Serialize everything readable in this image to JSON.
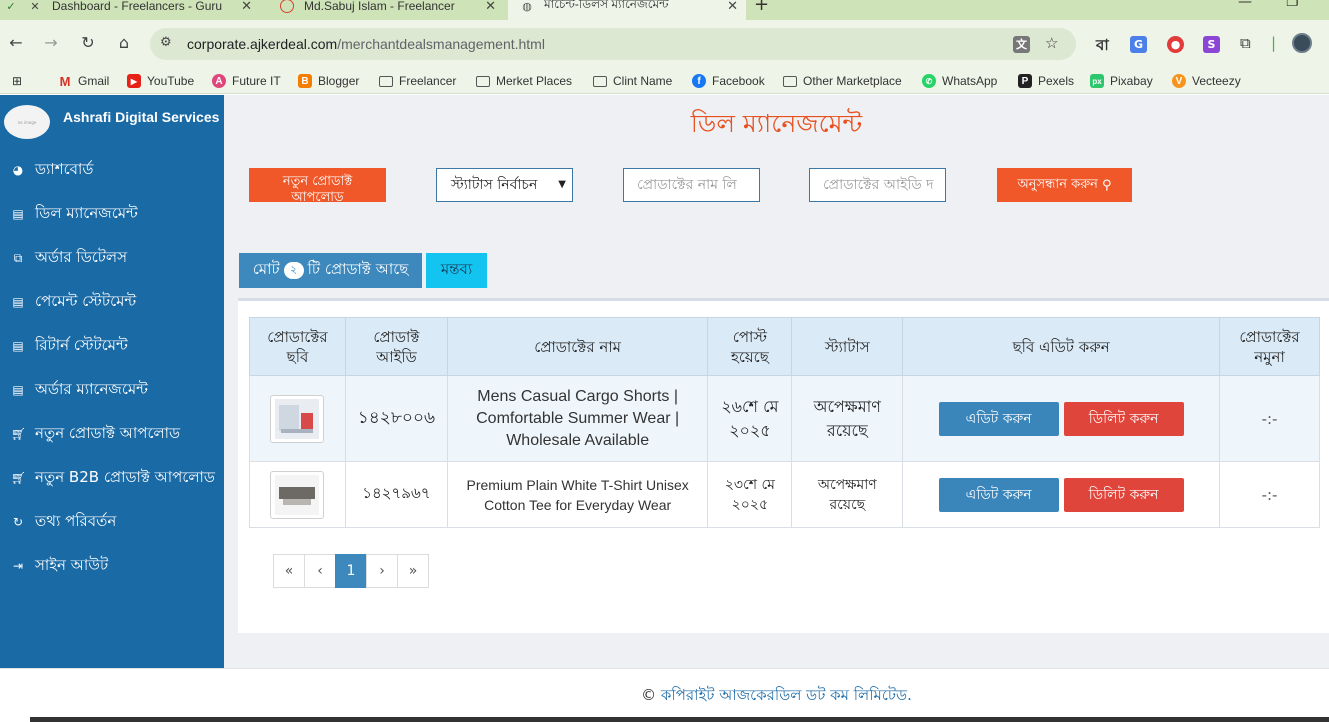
{
  "browser": {
    "tabs": [
      {
        "label": "Dashboard - Freelancers - Guru"
      },
      {
        "label": "Md.Sabuj Islam - Freelancer"
      },
      {
        "label": "মার্চেন্ট-ডিলস ম্যানেজমেন্ট"
      }
    ],
    "url_host": "corporate.ajkerdeal.com",
    "url_path": "/merchantdealsmanagement.html",
    "lang_badge": "বা",
    "bookmarks": [
      {
        "label": "Gmail"
      },
      {
        "label": "YouTube"
      },
      {
        "label": "Future IT"
      },
      {
        "label": "Blogger"
      },
      {
        "label": "Freelancer"
      },
      {
        "label": "Merket Places"
      },
      {
        "label": "Clint Name"
      },
      {
        "label": "Facebook"
      },
      {
        "label": "Other Marketplace"
      },
      {
        "label": "WhatsApp"
      },
      {
        "label": "Pexels"
      },
      {
        "label": "Pixabay"
      },
      {
        "label": "Vecteezy"
      }
    ]
  },
  "sidebar": {
    "logo_text": "no image",
    "brand": "Ashrafi Digital Services",
    "items": [
      {
        "label": "ড্যাশবোর্ড"
      },
      {
        "label": "ডিল ম্যানেজমেন্ট"
      },
      {
        "label": "অর্ডার ডিটেলস"
      },
      {
        "label": "পেমেন্ট স্টেটমেন্ট"
      },
      {
        "label": "রিটার্ন স্টেটমেন্ট"
      },
      {
        "label": "অর্ডার ম্যানেজমেন্ট"
      },
      {
        "label": "নতুন প্রোডাক্ট আপলোড"
      },
      {
        "label": "নতুন B2B প্রোডাক্ট আপলোড"
      },
      {
        "label": "তথ্য পরিবর্তন"
      },
      {
        "label": "সাইন আউট"
      }
    ]
  },
  "main": {
    "title": "ডিল ম্যানেজমেন্ট",
    "new_product_button": "নতুন প্রোডাক্ট আপলোড",
    "status_select": "স্ট্যাটাস নির্বাচন",
    "name_placeholder": "প্রোডাক্টের নাম লি",
    "id_placeholder": "প্রোডাক্টের আইডি দ",
    "search_button": "অনুসন্ধান করুন",
    "total_prefix": "মোট",
    "total_count": "২",
    "total_suffix": "টি প্রোডাক্ট আছে",
    "comment_button": "মন্তব্য"
  },
  "table": {
    "headers": {
      "image": "প্রোডাক্টের ছবি",
      "id": "প্রোডাক্ট আইডি",
      "name": "প্রোডাক্টের নাম",
      "posted": "পোস্ট হয়েছে",
      "status": "স্ট্যাটাস",
      "edit_image": "ছবি এডিট করুন",
      "sample": "প্রোডাক্টের নমুনা"
    },
    "rows": [
      {
        "id": "১৪২৮০০৬",
        "name": "Mens Casual Cargo Shorts | Comfortable Summer Wear | Wholesale Available",
        "posted": "২৬শে মে ২০২৫",
        "status": "অপেক্ষমাণ রয়েছে",
        "edit": "এডিট করুন",
        "delete": "ডিলিট করুন",
        "sample": "-:-"
      },
      {
        "id": "১৪২৭৯৬৭",
        "name": "Premium Plain White T-Shirt Unisex Cotton Tee for Everyday Wear",
        "posted": "২৩শে মে ২০২৫",
        "status": "অপেক্ষমাণ রয়েছে",
        "edit": "এডিট করুন",
        "delete": "ডিলিট করুন",
        "sample": "-:-"
      }
    ]
  },
  "pagination": {
    "first": "«",
    "prev": "‹",
    "current": "1",
    "next": "›",
    "last": "»"
  },
  "footer": {
    "symbol": "©",
    "text": "কপিরাইট আজকেরডিল ডট কম লিমিটেড."
  },
  "colors": {
    "sidebar": "#1a6aa6",
    "accent_orange": "#f0582a",
    "delete_red": "#e0453c",
    "primary_blue": "#3d88bd"
  }
}
